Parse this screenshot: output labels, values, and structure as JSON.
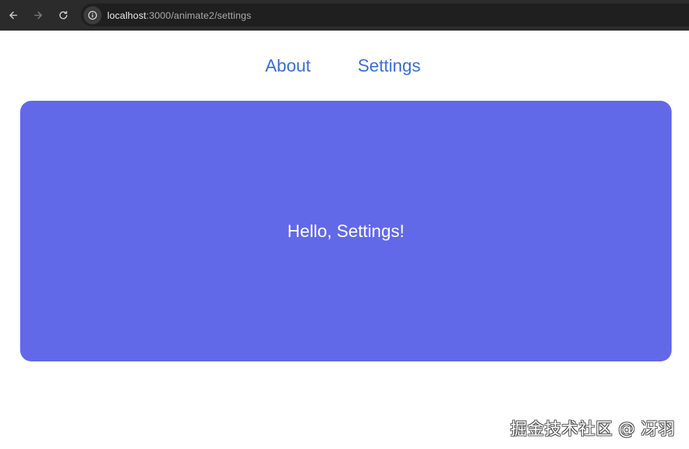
{
  "browser": {
    "url_host": "localhost",
    "url_path": ":3000/animate2/settings"
  },
  "nav": {
    "about_label": "About",
    "settings_label": "Settings",
    "link_color": "#3b6ed6"
  },
  "card": {
    "message": "Hello, Settings!",
    "background_color": "#6269e8"
  },
  "watermark": {
    "text": "掘金技术社区 @ 冴羽"
  }
}
